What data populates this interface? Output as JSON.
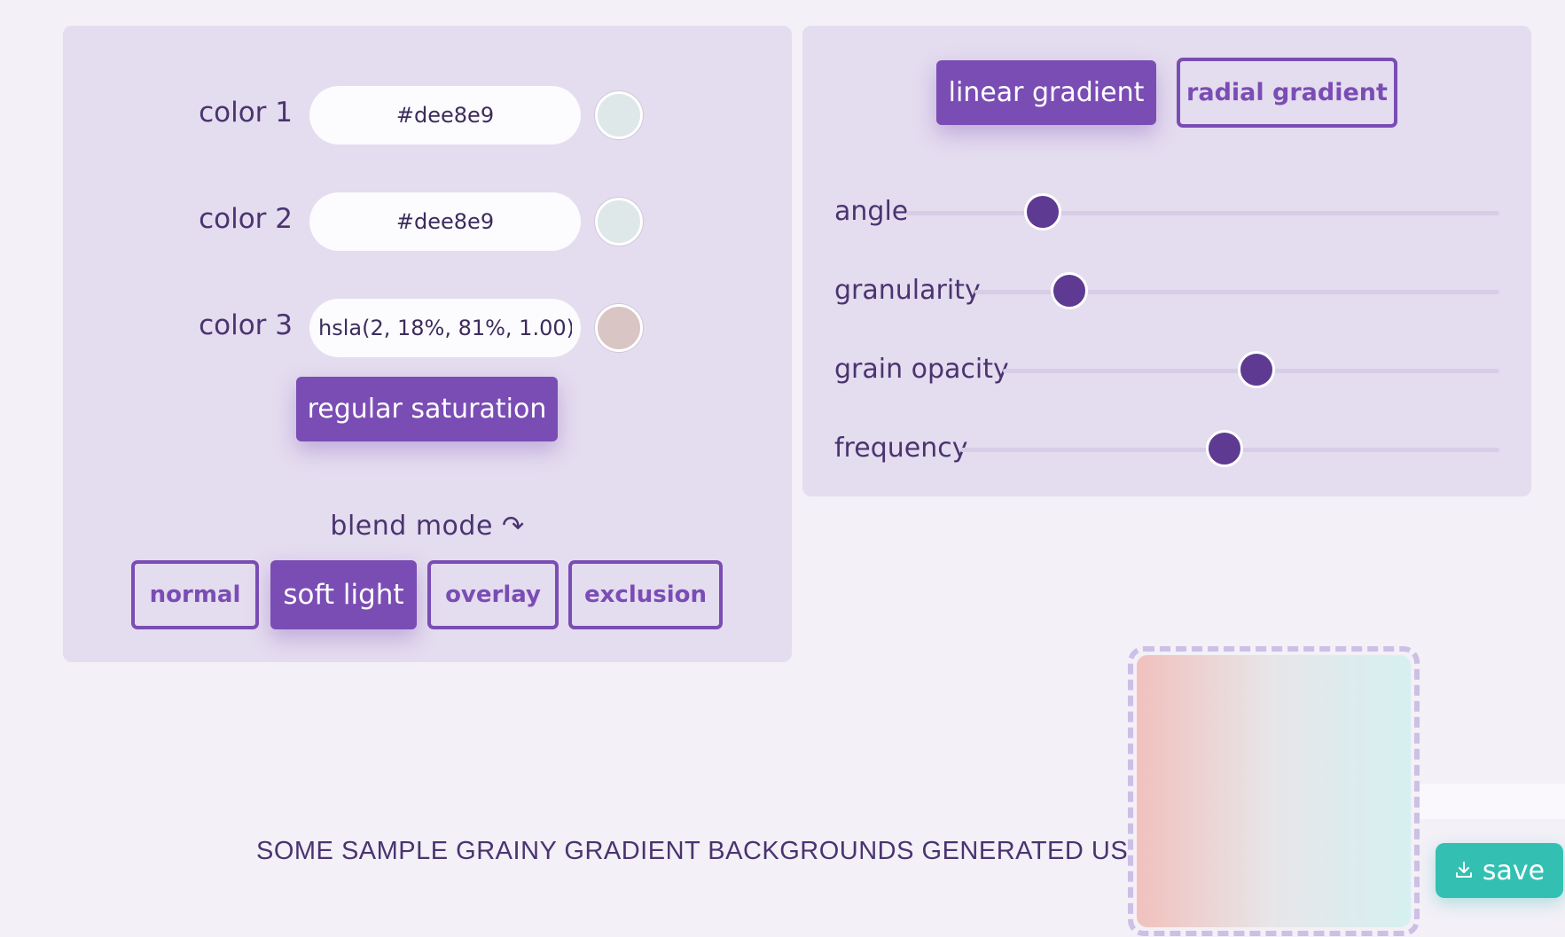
{
  "colors": {
    "accent": "#7a4db4",
    "accent_dark": "#5e3a92",
    "save": "#33c0b3",
    "panel": "#e4dcef"
  },
  "color_inputs": [
    {
      "label": "color 1",
      "value": "#dee8e9",
      "swatch": "#dee8e9"
    },
    {
      "label": "color 2",
      "value": "#dee8e9",
      "swatch": "#dee8e9"
    },
    {
      "label": "color 3",
      "value": "hsla(2, 18%, 81%, 1.00)",
      "swatch": "#d8c5c4"
    }
  ],
  "saturation_button": "regular saturation",
  "blend": {
    "title": "blend mode ↷",
    "modes": [
      "normal",
      "soft light",
      "overlay",
      "exclusion"
    ],
    "selected": "soft light"
  },
  "gradient_tabs": {
    "linear": "linear gradient",
    "radial": "radial gradient",
    "selected": "linear gradient"
  },
  "sliders": [
    {
      "label": "angle",
      "value": 0.23
    },
    {
      "label": "granularity",
      "value": 0.18
    },
    {
      "label": "grain opacity",
      "value": 0.51
    },
    {
      "label": "frequency",
      "value": 0.49
    }
  ],
  "sample_text": "SOME SAMPLE GRAINY GRADIENT BACKGROUNDS GENERATED US",
  "preview": {
    "gradient_colors": [
      "#f1c1bd",
      "#e7e6e9",
      "#d6f0f1"
    ]
  },
  "save": {
    "label": "save",
    "icon": "download-icon"
  }
}
